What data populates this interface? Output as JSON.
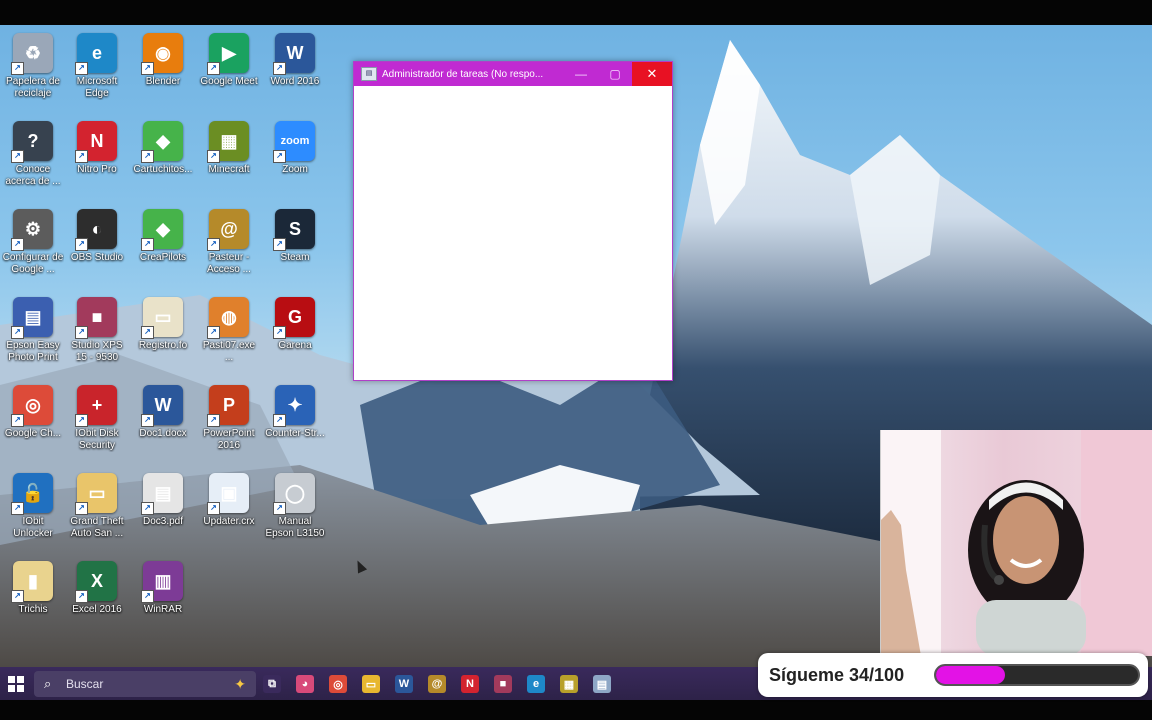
{
  "desktop_icons": [
    {
      "id": "recycle",
      "label": "Papelera de reciclaje",
      "icon": "recycle-bin-icon",
      "glyph": "♻",
      "color": "#9aa7b8"
    },
    {
      "id": "edge",
      "label": "Microsoft Edge",
      "icon": "edge-icon",
      "glyph": "e",
      "color": "#1e88c8"
    },
    {
      "id": "blender",
      "label": "Blender",
      "icon": "blender-icon",
      "glyph": "◉",
      "color": "#e87d0d"
    },
    {
      "id": "meet",
      "label": "Google Meet",
      "icon": "google-meet-icon",
      "glyph": "▶",
      "color": "#1aa260"
    },
    {
      "id": "word2016",
      "label": "Word 2016",
      "icon": "word-icon",
      "glyph": "W",
      "color": "#2b579a"
    },
    {
      "id": "conoce",
      "label": "Conoce acerca de ...",
      "icon": "help-circle-icon",
      "glyph": "?",
      "color": "#37424f"
    },
    {
      "id": "nitro",
      "label": "Nitro Pro",
      "icon": "nitro-pro-icon",
      "glyph": "N",
      "color": "#d3232f"
    },
    {
      "id": "cartuchitos",
      "label": "Cartuchitos...",
      "icon": "green-shield-icon",
      "glyph": "◆",
      "color": "#46b34a"
    },
    {
      "id": "minecraft",
      "label": "Minecraft",
      "icon": "minecraft-icon",
      "glyph": "▦",
      "color": "#6b8e23"
    },
    {
      "id": "zoom",
      "label": "Zoom",
      "icon": "zoom-icon",
      "glyph": "zoom",
      "color": "#2d8cff"
    },
    {
      "id": "configurar",
      "label": "Configurar de Google ...",
      "icon": "config-icon",
      "glyph": "⚙",
      "color": "#5c5c5c"
    },
    {
      "id": "obs",
      "label": "OBS Studio",
      "icon": "obs-icon",
      "glyph": "◐",
      "color": "#2d2d2d"
    },
    {
      "id": "creapilot",
      "label": "CreaPilots",
      "icon": "green-shield-icon",
      "glyph": "◆",
      "color": "#46b34a"
    },
    {
      "id": "pasteur",
      "label": "Pasteur - Acceso ...",
      "icon": "ammonite-icon",
      "glyph": "@",
      "color": "#b58a2a"
    },
    {
      "id": "steam",
      "label": "Steam",
      "icon": "steam-icon",
      "glyph": "S",
      "color": "#1b2838"
    },
    {
      "id": "epson",
      "label": "Epson Easy Photo Print",
      "icon": "photo-print-icon",
      "glyph": "▤",
      "color": "#3b5fb0"
    },
    {
      "id": "studio",
      "label": "Studio XPS 15 - 9530",
      "icon": "tiles-icon",
      "glyph": "■",
      "color": "#a23a5c"
    },
    {
      "id": "registro",
      "label": "Registro.fo",
      "icon": "document-icon",
      "glyph": "▭",
      "color": "#e9e2c9"
    },
    {
      "id": "pasmo",
      "label": "Pasti07.exe ...",
      "icon": "shell-icon",
      "glyph": "◍",
      "color": "#e0802c"
    },
    {
      "id": "garena",
      "label": "Garena",
      "icon": "garena-icon",
      "glyph": "G",
      "color": "#b80d12"
    },
    {
      "id": "chrome",
      "label": "Google Ch...",
      "icon": "chrome-icon",
      "glyph": "◎",
      "color": "#dd4b39"
    },
    {
      "id": "iobitdisk",
      "label": "IObit Disk Security",
      "icon": "shield-icon",
      "glyph": "+",
      "color": "#c9242b"
    },
    {
      "id": "doc1",
      "label": "Doc1.docx",
      "icon": "word-doc-icon",
      "glyph": "W",
      "color": "#2b579a"
    },
    {
      "id": "ppt",
      "label": "PowerPoint 2016",
      "icon": "powerpoint-icon",
      "glyph": "P",
      "color": "#c43e1c"
    },
    {
      "id": "counter",
      "label": "Counter-Str...",
      "icon": "counter-strike-icon",
      "glyph": "✦",
      "color": "#2a63b7"
    },
    {
      "id": "unlocker",
      "label": "IObit Unlocker",
      "icon": "unlock-icon",
      "glyph": "🔓",
      "color": "#2070c0"
    },
    {
      "id": "gta",
      "label": "Grand Theft Auto San ...",
      "icon": "folder-icon",
      "glyph": "▭",
      "color": "#e9c56a"
    },
    {
      "id": "doc3",
      "label": "Doc3.pdf",
      "icon": "pdf-icon",
      "glyph": "▤",
      "color": "#e5e5e5"
    },
    {
      "id": "updater",
      "label": "Updater.crx",
      "icon": "window-icon",
      "glyph": "▣",
      "color": "#e6eef7"
    },
    {
      "id": "manual",
      "label": "Manual Epson L3150",
      "icon": "disc-icon",
      "glyph": "◯",
      "color": "#c7ccd2"
    },
    {
      "id": "trichis",
      "label": "Trichis",
      "icon": "archive-icon",
      "glyph": "▮",
      "color": "#e9d38e"
    },
    {
      "id": "excel",
      "label": "Excel 2016",
      "icon": "excel-icon",
      "glyph": "X",
      "color": "#217346"
    },
    {
      "id": "winrar",
      "label": "WinRAR",
      "icon": "winrar-icon",
      "glyph": "▥",
      "color": "#7d3b96"
    }
  ],
  "task_manager": {
    "title": "Administrador de tareas (No respo...",
    "minimize": "—",
    "maximize": "▢",
    "close": "✕"
  },
  "taskbar": {
    "search_placeholder": "Buscar",
    "pinned": [
      {
        "icon": "task-view-icon",
        "glyph": "⧉",
        "color": "#3a2a5c"
      },
      {
        "icon": "colorful-app-icon",
        "glyph": "◕",
        "color": "#d84a7a"
      },
      {
        "icon": "chrome-icon",
        "glyph": "◎",
        "color": "#dd4b39"
      },
      {
        "icon": "file-explorer-icon",
        "glyph": "▭",
        "color": "#e8b730"
      },
      {
        "icon": "word-icon",
        "glyph": "W",
        "color": "#2b579a"
      },
      {
        "icon": "pasteur-icon",
        "glyph": "@",
        "color": "#b58a2a"
      },
      {
        "icon": "nitro-icon",
        "glyph": "N",
        "color": "#d3232f"
      },
      {
        "icon": "tiles-icon",
        "glyph": "■",
        "color": "#a23a5c"
      },
      {
        "icon": "edge-icon",
        "glyph": "e",
        "color": "#1e88c8"
      },
      {
        "icon": "notes-icon",
        "glyph": "▦",
        "color": "#b8a02a"
      },
      {
        "icon": "task-manager-icon",
        "glyph": "▤",
        "color": "#8ea7c6"
      }
    ]
  },
  "follow_overlay": {
    "label": "Sígueme 34/100",
    "progress": 0.34
  }
}
